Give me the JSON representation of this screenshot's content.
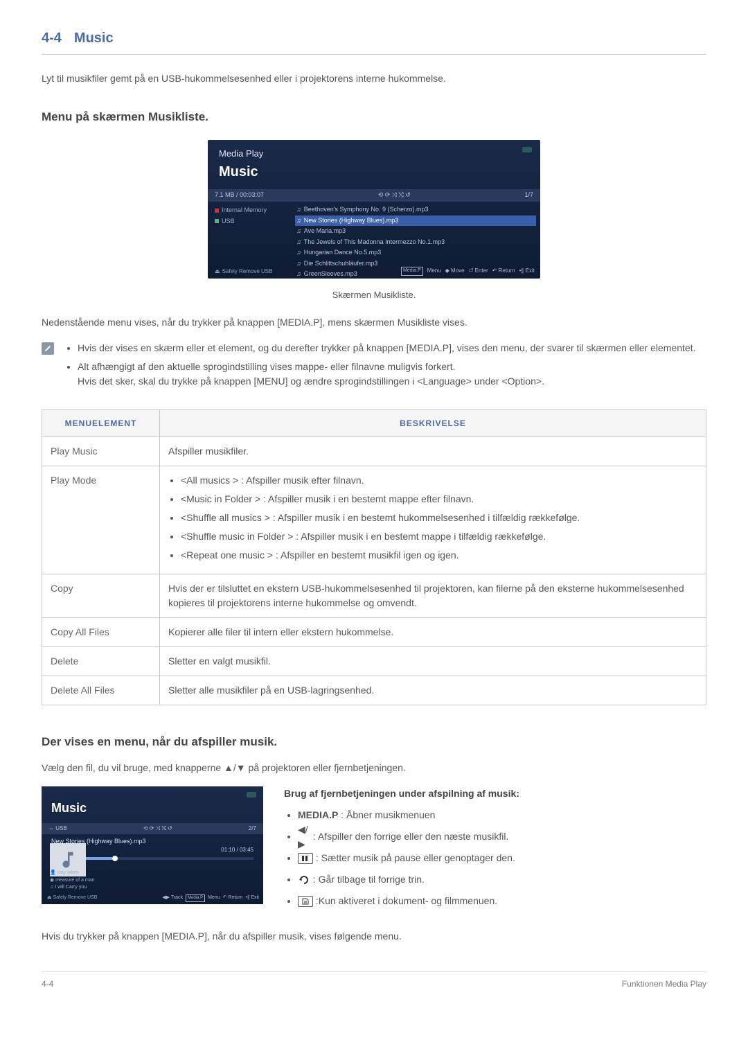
{
  "header": {
    "section_number": "4-4",
    "section_title": "Music"
  },
  "intro": "Lyt til musikfiler gemt på en USB-hukommelsesenhed eller i projektorens interne hukommelse.",
  "section1": {
    "heading": "Menu på skærmen Musikliste.",
    "caption": "Skærmen Musikliste.",
    "below": "Nedenstående menu vises, når du trykker på knappen [MEDIA.P], mens skærmen Musikliste vises.",
    "notes": [
      "Hvis der vises en skærm eller et element, og du derefter trykker på knappen [MEDIA.P], vises den menu, der svarer til skærmen eller elementet.",
      "Alt afhængigt af den aktuelle sprogindstilling vises mappe- eller filnavne muligvis forkert.\nHvis det sker, skal du trykke på knappen [MENU] og ændre sprogindstillingen i <Language> under <Option>."
    ]
  },
  "screenshot1": {
    "app": "Media Play",
    "title": "Music",
    "stat": "7.1 MB / 00:03:07",
    "page": "1/7",
    "side": {
      "mem": "Internal Memory",
      "usb": "USB"
    },
    "files": [
      "Beethoven's Symphony No. 9 (Scherzo).mp3",
      "New Stories (Highway Blues).mp3",
      "Ave Maria.mp3",
      "The Jewels of This Madonna Intermezzo No.1.mp3",
      "Hungarian Dance No.5.mp3",
      "Die Schlittschuhläufer.mp3",
      "GreenSleeves.mp3"
    ],
    "footer": {
      "remove": "Safely Remove USB",
      "mediap": "Media.P",
      "menu": "Menu",
      "move": "Move",
      "enter": "Enter",
      "return": "Return",
      "exit": "Exit"
    }
  },
  "table": {
    "headers": {
      "col1": "MENUELEMENT",
      "col2": "BESKRIVELSE"
    },
    "rows": [
      {
        "name": "Play Music",
        "desc": "Afspiller musikfiler."
      },
      {
        "name": "Play Mode",
        "items": [
          "<All musics > : Afspiller musik efter filnavn.",
          "<Music in Folder > : Afspiller musik i en bestemt mappe efter filnavn.",
          "<Shuffle all musics > : Afspiller musik i en bestemt hukommelsesenhed i tilfældig rækkefølge.",
          "<Shuffle music in Folder > : Afspiller musik i en bestemt mappe i tilfældig rækkefølge.",
          "<Repeat one music > : Afspiller en bestemt musikfil igen og igen."
        ]
      },
      {
        "name": "Copy",
        "desc": "Hvis der er tilsluttet en ekstern USB-hukommelsesenhed til projektoren, kan filerne på den eksterne hukommelsesenhed kopieres til projektorens interne hukommelse og omvendt."
      },
      {
        "name": "Copy All Files",
        "desc": "Kopierer alle filer til intern eller ekstern hukommelse."
      },
      {
        "name": "Delete",
        "desc": "Sletter en valgt musikfil."
      },
      {
        "name": "Delete All Files",
        "desc": "Sletter alle musikfiler på en USB-lagringsenhed."
      }
    ]
  },
  "section2": {
    "heading": "Der vises en menu, når du afspiller musik.",
    "para": "Vælg den fil, du vil bruge, med knapperne ▲/▼ på projektoren eller fjernbetjeningen.",
    "remote_title": "Brug af fjernbetjeningen under afspilning af musik:",
    "remote": [
      {
        "label": "MEDIA.P",
        "text": " : Åbner musikmenuen"
      },
      {
        "icon": "arrows",
        "text": " : Afspiller den forrige eller den næste musikfil."
      },
      {
        "icon": "pause",
        "text": " : Sætter musik på pause eller genoptager den."
      },
      {
        "icon": "back",
        "text": " : Går tilbage til forrige trin."
      },
      {
        "icon": "doc",
        "text": " :Kun aktiveret i dokument- og filmmenuen."
      }
    ],
    "below": "Hvis du trykker på knappen [MEDIA.P], når du afspiller musik, vises følgende menu."
  },
  "screenshot2": {
    "title": "Music",
    "usb": "USB",
    "page": "2/7",
    "track": "New Stories (Highway Blues).mp3",
    "time": "01:10 / 03:45",
    "info": {
      "artist": "clay aiken",
      "album": "measure of a man",
      "song": "I will Carry you"
    },
    "footer": {
      "remove": "Safely Remove USB",
      "track": "Track",
      "mediap": "Media.P",
      "menu": "Menu",
      "return": "Return",
      "exit": "Exit"
    }
  },
  "footer": {
    "left": "4-4",
    "right": "Funktionen Media Play"
  }
}
